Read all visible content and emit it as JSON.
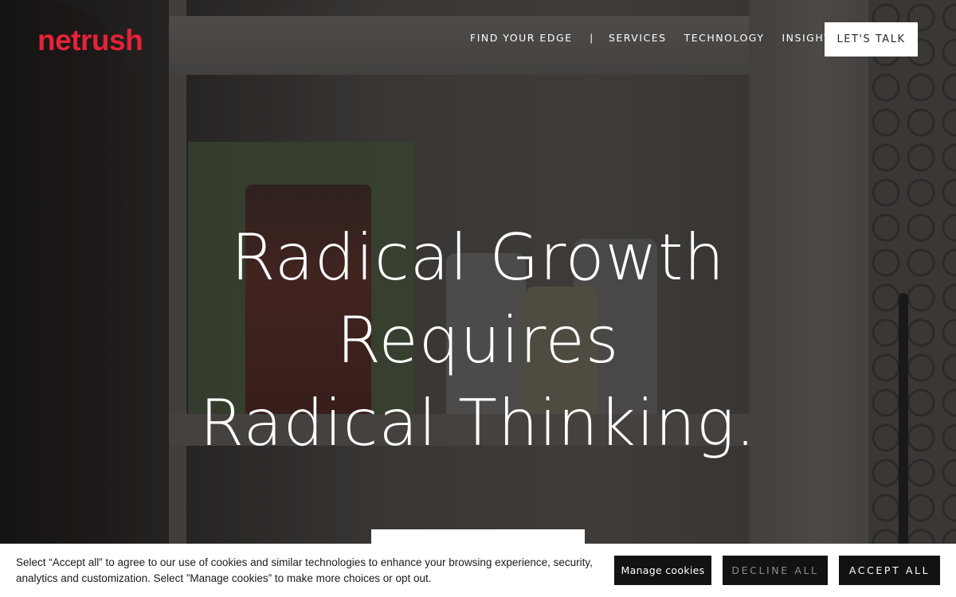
{
  "brand": {
    "logo_text": "netrush",
    "logo_color": "#e5223a"
  },
  "nav": {
    "items": [
      "FIND YOUR EDGE",
      "SERVICES",
      "TECHNOLOGY",
      "INSIGHTS"
    ],
    "separator": "|",
    "cta_label": "LET'S TALK"
  },
  "hero": {
    "headline_lines": [
      "Radical Growth",
      "Requires",
      "Radical Thinking."
    ],
    "background": "video frame of a medicine cabinet shelf with supplement bottles"
  },
  "cookie_banner": {
    "message": "Select “Accept all” to agree to our use of cookies and similar technologies to enhance your browsing experience, security, analytics and customization. Select ”Manage cookies” to make more choices or opt out.",
    "manage_label": "Manage cookies",
    "decline_label": "DECLINE ALL",
    "accept_label": "ACCEPT ALL"
  },
  "colors": {
    "accent": "#e5223a",
    "button_dark": "#121212",
    "banner_bg": "#ffffff"
  }
}
